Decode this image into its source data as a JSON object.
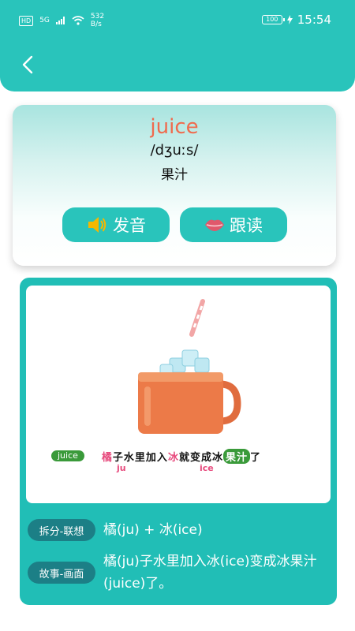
{
  "status": {
    "hd": "HD",
    "signal": "5G",
    "speed_value": "532",
    "speed_unit": "B/s",
    "battery": "100",
    "time": "15:54"
  },
  "word_card": {
    "word": "juice",
    "phonetic": "/dʒuːs/",
    "meaning": "果汁",
    "pronounce_label": "发音",
    "follow_label": "跟读"
  },
  "illustration": {
    "tag": "juice",
    "s1": "橘",
    "s2": "子水里加入",
    "s3": "冰",
    "s4": "就变成冰",
    "s5": "果汁",
    "s6": "了",
    "sub_ju": "ju",
    "sub_ice": "ice"
  },
  "memory": {
    "split_label": "拆分-联想",
    "split_text": "橘(ju) + 冰(ice)",
    "story_label": "故事-画面",
    "story_text": "橘(ju)子水里加入冰(ice)变成冰果汁(juice)了。"
  },
  "colors": {
    "accent": "#29c4bb",
    "word": "#f06a4d",
    "pill": "#1c7f86"
  }
}
